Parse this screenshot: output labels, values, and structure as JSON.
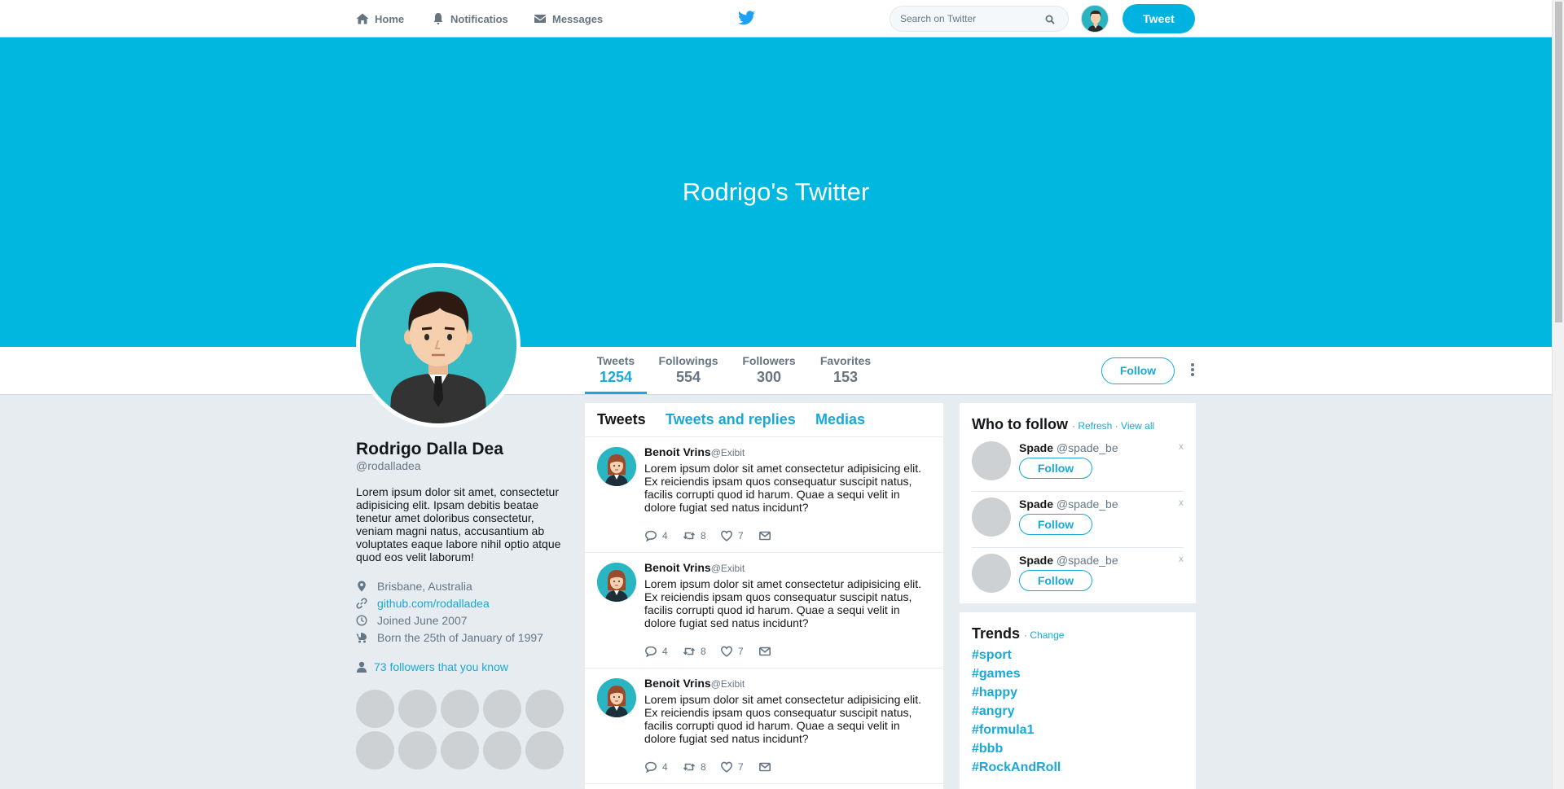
{
  "nav": {
    "home": "Home",
    "notifications": "Notificatios",
    "messages": "Messages",
    "search_placeholder": "Search on Twitter",
    "tweet_button": "Tweet"
  },
  "banner": {
    "title": "Rodrigo's Twitter"
  },
  "stats": [
    {
      "label": "Tweets",
      "value": "1254"
    },
    {
      "label": "Followings",
      "value": "554"
    },
    {
      "label": "Followers",
      "value": "300"
    },
    {
      "label": "Favorites",
      "value": "153"
    }
  ],
  "follow_button": "Follow",
  "profile": {
    "name": "Rodrigo Dalla Dea",
    "handle": "@rodalladea",
    "bio": "Lorem ipsum dolor sit amet, consectetur adipisicing elit. Ipsam debitis beatae tenetur amet doloribus consectetur, veniam magni natus, accusantium ab voluptates eaque labore nihil optio atque quod eos velit laborum!",
    "location": "Brisbane, Australia",
    "website": "github.com/rodalladea",
    "joined": "Joined June 2007",
    "born": "Born the 25th of January of 1997",
    "followers_you_know": "73 followers that you know"
  },
  "timeline": {
    "tabs": [
      "Tweets",
      "Tweets and replies",
      "Medias"
    ],
    "tweets": [
      {
        "name": "Benoit Vrins",
        "handle": "@Exibit",
        "text": "Lorem ipsum dolor sit amet consectetur adipisicing elit. Ex reiciendis ipsam quos consequatur suscipit natus, facilis corrupti quod id harum. Quae a sequi velit in dolore fugiat sed natus incidunt?",
        "replies": "4",
        "retweets": "8",
        "likes": "7"
      },
      {
        "name": "Benoit Vrins",
        "handle": "@Exibit",
        "text": "Lorem ipsum dolor sit amet consectetur adipisicing elit. Ex reiciendis ipsam quos consequatur suscipit natus, facilis corrupti quod id harum. Quae a sequi velit in dolore fugiat sed natus incidunt?",
        "replies": "4",
        "retweets": "8",
        "likes": "7"
      },
      {
        "name": "Benoit Vrins",
        "handle": "@Exibit",
        "text": "Lorem ipsum dolor sit amet consectetur adipisicing elit. Ex reiciendis ipsam quos consequatur suscipit natus, facilis corrupti quod id harum. Quae a sequi velit in dolore fugiat sed natus incidunt?",
        "replies": "4",
        "retweets": "8",
        "likes": "7"
      }
    ]
  },
  "who_to_follow": {
    "title": "Who to follow",
    "refresh": "Refresh",
    "view_all": "View all",
    "close": "x",
    "follow_label": "Follow",
    "items": [
      {
        "name": "Spade",
        "handle": "@spade_be"
      },
      {
        "name": "Spade",
        "handle": "@spade_be"
      },
      {
        "name": "Spade",
        "handle": "@spade_be"
      }
    ]
  },
  "trends": {
    "title": "Trends",
    "change": "Change",
    "items": [
      "#sport",
      "#games",
      "#happy",
      "#angry",
      "#formula1",
      "#bbb",
      "#RockAndRoll"
    ]
  },
  "colors": {
    "accent": "#19a8d8",
    "banner": "#00b8df",
    "background": "#e6ecf0"
  },
  "icons": [
    "home-icon",
    "bell-icon",
    "envelope-icon",
    "twitter-bird-icon",
    "search-icon",
    "map-marker-icon",
    "link-icon",
    "clock-icon",
    "baby-carriage-icon",
    "user-icon",
    "comment-icon",
    "retweet-icon",
    "heart-icon",
    "mail-icon",
    "kebab-menu-icon"
  ]
}
